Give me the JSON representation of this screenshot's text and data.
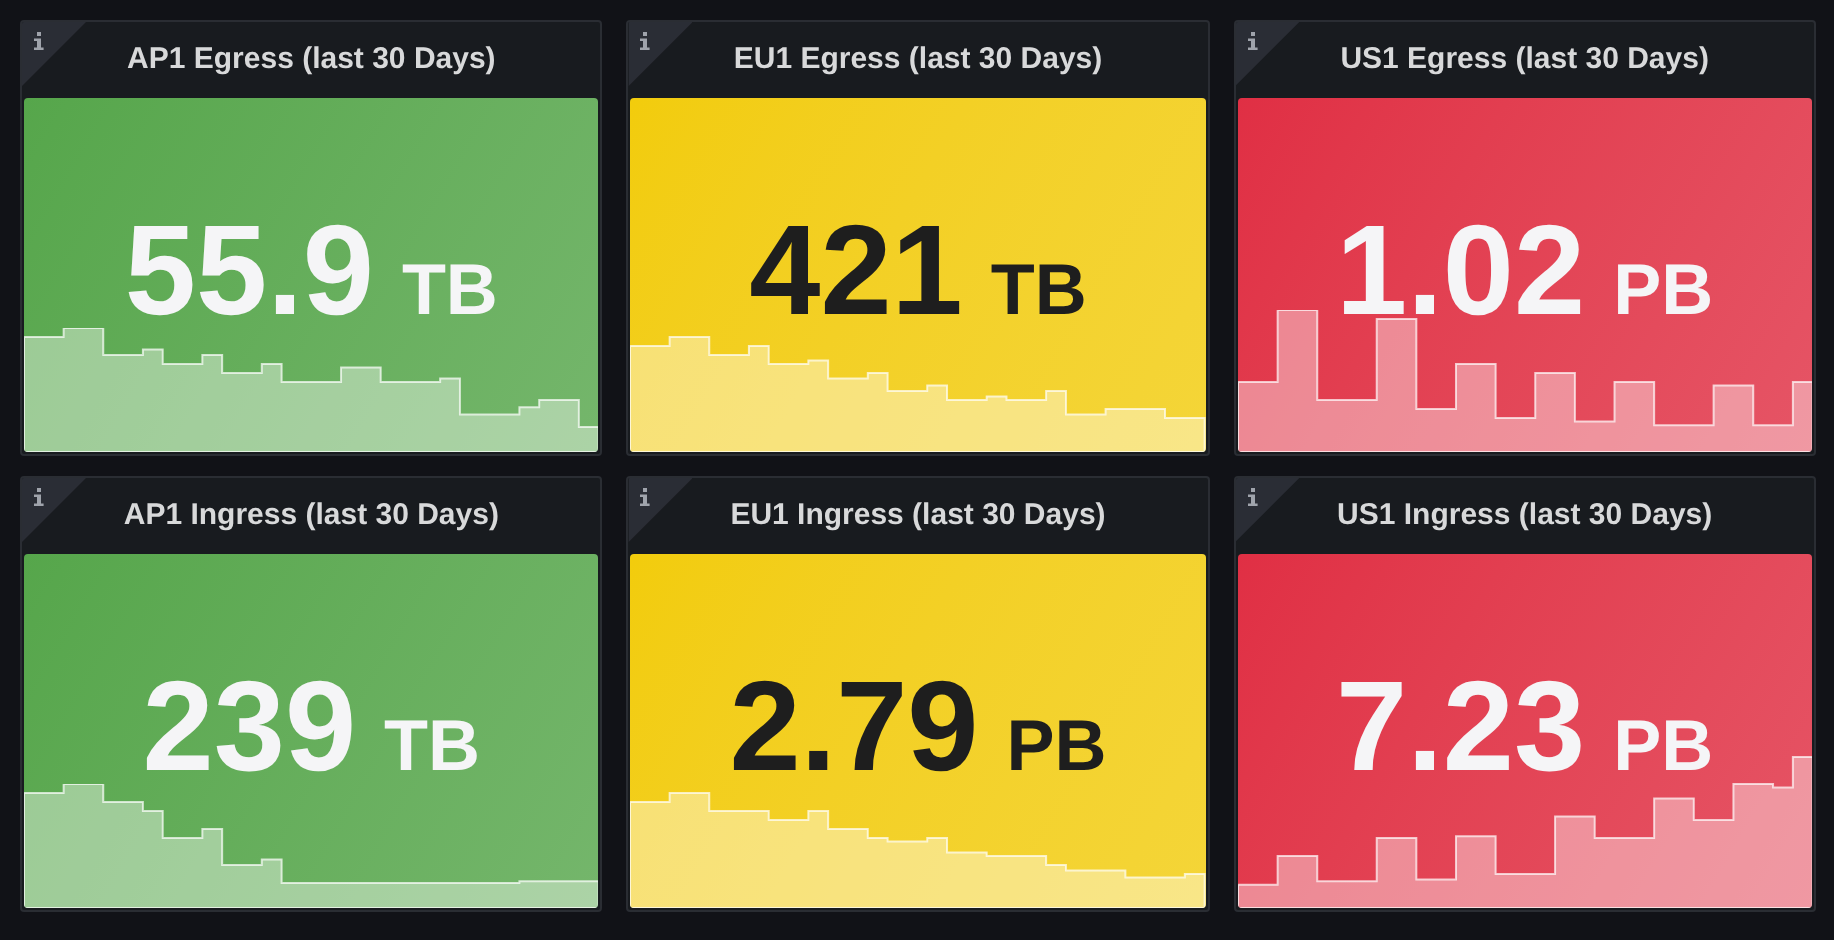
{
  "panels": [
    {
      "title": "AP1 Egress (last 30 Days)",
      "value": "55.9",
      "unit": "TB",
      "color": "#56a64b"
    },
    {
      "title": "EU1 Egress (last 30 Days)",
      "value": "421",
      "unit": "TB",
      "color": "#f2cc0c"
    },
    {
      "title": "US1 Egress (last 30 Days)",
      "value": "1.02",
      "unit": "PB",
      "color": "#e02f44"
    },
    {
      "title": "AP1 Ingress (last 30 Days)",
      "value": "239",
      "unit": "TB",
      "color": "#56a64b"
    },
    {
      "title": "EU1 Ingress (last 30 Days)",
      "value": "2.79",
      "unit": "PB",
      "color": "#f2cc0c"
    },
    {
      "title": "US1 Ingress (last 30 Days)",
      "value": "7.23",
      "unit": "PB",
      "color": "#e02f44"
    }
  ]
}
